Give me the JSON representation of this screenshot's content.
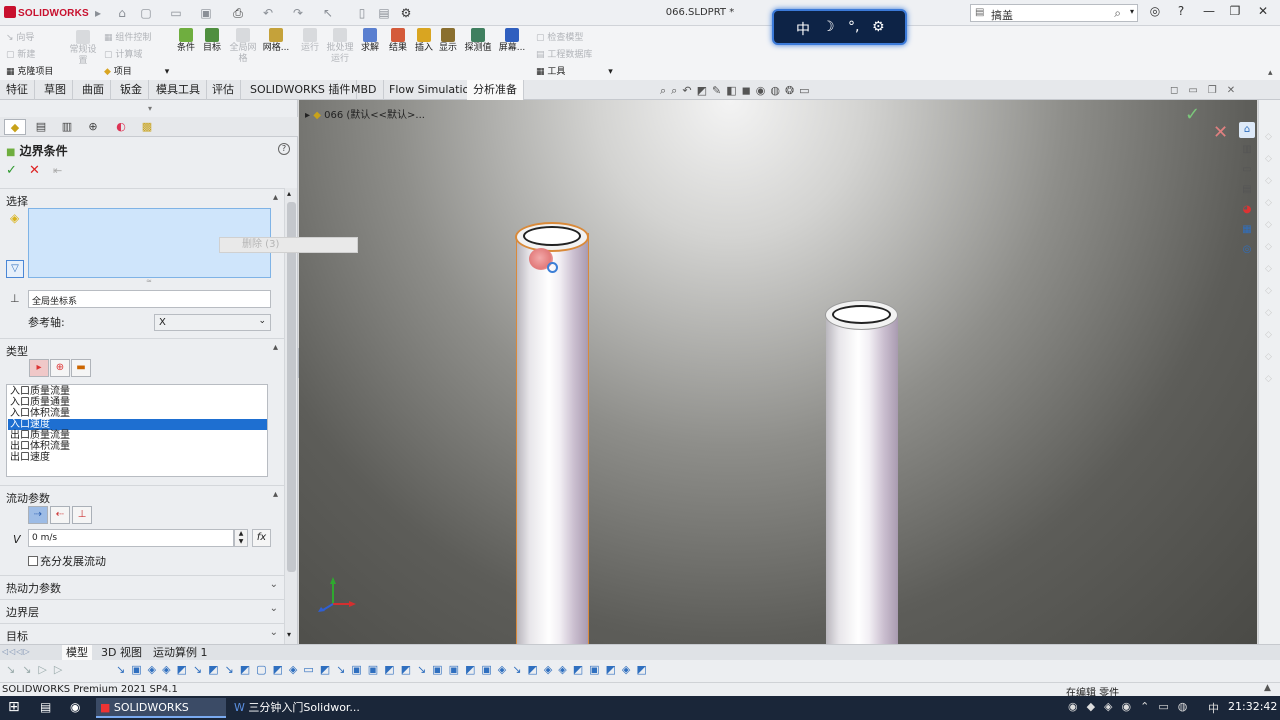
{
  "app": {
    "logo": "SOLIDWORKS",
    "doc_title": "066.SLDPRT *",
    "search_value": "搞盖",
    "ime": {
      "lang": "中",
      "moon": "☽",
      "dots": "°,",
      "gear": "⚙"
    }
  },
  "commands_left": [
    {
      "label": "向导",
      "disabled": true
    },
    {
      "label": "新建",
      "disabled": true
    },
    {
      "label": "克隆项目",
      "disabled": false
    }
  ],
  "commands": [
    {
      "label": "常规设\n置",
      "disabled": true
    },
    {
      "label": "组件控制",
      "disabled": true
    },
    {
      "label": "计算域",
      "disabled": true
    },
    {
      "label": "项目",
      "disabled": false
    },
    {
      "label": "条件",
      "disabled": false
    },
    {
      "label": "目标",
      "disabled": false
    },
    {
      "label": "全局网\n格",
      "disabled": true
    },
    {
      "label": "网格...",
      "disabled": false
    },
    {
      "label": "运行",
      "disabled": true
    },
    {
      "label": "批处理\n运行",
      "disabled": true
    },
    {
      "label": "求解",
      "disabled": false
    },
    {
      "label": "结果",
      "disabled": false
    },
    {
      "label": "插入",
      "disabled": false
    },
    {
      "label": "显示",
      "disabled": false
    },
    {
      "label": "探测值",
      "disabled": false
    },
    {
      "label": "屏幕...",
      "disabled": false
    },
    {
      "label": "检查模型",
      "disabled": true
    },
    {
      "label": "工程数据库",
      "disabled": true
    },
    {
      "label": "工具",
      "disabled": false
    }
  ],
  "tabs": [
    "特征",
    "草图",
    "曲面",
    "钣金",
    "模具工具",
    "评估",
    "SOLIDWORKS 插件",
    "MBD",
    "Flow Simulation",
    "分析准备"
  ],
  "active_tab": "分析准备",
  "panel": {
    "title": "边界条件",
    "help": "?",
    "sections": {
      "selection": "选择",
      "type": "类型",
      "flow_params": "流动参数",
      "thermo": "热动力参数",
      "boundary_layer": "边界层",
      "goal": "目标"
    },
    "delete_tip": "删除 (3)",
    "coord_system": "全局坐标系",
    "ref_axis_label": "参考轴:",
    "ref_axis_value": "X",
    "type_list": [
      "入口质量流量",
      "入口质量通量",
      "入口体积流量",
      "入口速度",
      "出口质量流量",
      "出口体积流量",
      "出口速度"
    ],
    "selected_type": "入口速度",
    "velocity_symbol": "V",
    "velocity_value": "0 m/s",
    "fx": "fx",
    "fully_developed": "充分发展流动"
  },
  "viewport": {
    "breadcrumb": "066 (默认<<默认>..."
  },
  "bottom_tabs": [
    "模型",
    "3D 视图",
    "运动算例 1"
  ],
  "status": {
    "left": "SOLIDWORKS Premium 2021 SP4.1",
    "right": "在编辑 零件"
  },
  "taskbar": {
    "items": [
      "SOLIDWORKS Prem...",
      "三分钟入门Solidwor..."
    ],
    "ime": "中",
    "clock": "21:32:42"
  },
  "colors": {
    "accent": "#1e6fd1",
    "brand": "#c8102e",
    "ok": "#2f9a2f",
    "cancel": "#dd2222"
  }
}
